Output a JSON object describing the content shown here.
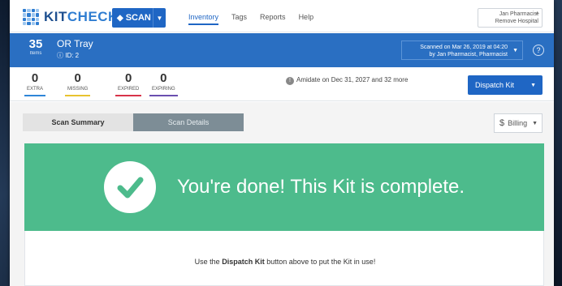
{
  "brand": {
    "logo_light": "KIT",
    "logo_bold": "CHECK"
  },
  "header": {
    "scan_label": "SCAN",
    "nav": [
      "Inventory",
      "Tags",
      "Reports",
      "Help"
    ],
    "user_name": "Jan Pharmacist",
    "user_org": "Remove Hospital"
  },
  "kit": {
    "count": "35",
    "count_label": "Items",
    "name": "OR Tray",
    "id": "ID: 2",
    "scanned_line1": "Scanned on Mar 26, 2019 at 04:20",
    "scanned_line2": "by Jan Pharmacist, Pharmacist"
  },
  "stats": [
    {
      "value": "0",
      "label": "EXTRA",
      "color": "#2e86d8"
    },
    {
      "value": "0",
      "label": "MISSING",
      "color": "#e8c32f"
    },
    {
      "value": "0",
      "label": "EXPIRED",
      "color": "#d8344a"
    },
    {
      "value": "0",
      "label": "EXPIRING",
      "color": "#6a4fb0"
    }
  ],
  "notice": "Amidate on Dec 31, 2027 and 32 more",
  "dispatch_label": "Dispatch Kit",
  "tabs": {
    "summary": "Scan Summary",
    "details": "Scan Details"
  },
  "billing_label": "Billing",
  "done_message": "You're done! This Kit is complete.",
  "instruction": {
    "pre": "Use the ",
    "bold": "Dispatch Kit",
    "post": " button above to put the Kit in use!"
  },
  "colors": {
    "brand_blue": "#2a6fc2",
    "success_green": "#4dbb8c"
  }
}
